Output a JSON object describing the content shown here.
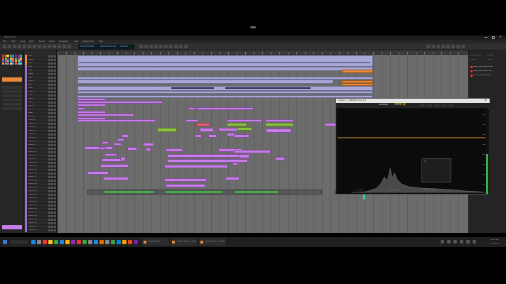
{
  "app": {
    "title": "Studio One"
  },
  "menus": [
    "File",
    "Edit",
    "Song",
    "Track",
    "Event",
    "Audio",
    "Transport",
    "View",
    "Studio One",
    "Help"
  ],
  "transport": {
    "time": "00:01:38.295",
    "bars": "0074.01.01.00",
    "tempo": "130.00",
    "signature": "4 / 4"
  },
  "tracks": [
    "Kick",
    "Snare",
    "Hat",
    "Perc",
    "Clap",
    "Bass",
    "Sub",
    "Chord",
    "Pad",
    "Lead",
    "Pluck",
    "Arp",
    "Keys",
    "Vox",
    "Vox 2",
    "FX",
    "Riser",
    "Impact",
    "Audio 1",
    "Audio 2",
    "Audio 3",
    "Audio 4",
    "Audio 5",
    "Audio 6",
    "Audio 7",
    "Audio 8",
    "Audio 9",
    "Audio 10",
    "Audio 11",
    "Audio 12",
    "Audio 13",
    "Audio 14",
    "Audio 15",
    "Audio 16",
    "Audio 17",
    "Audio 18",
    "Audio 19",
    "Audio 20",
    "Audio 21",
    "Audio 22",
    "Audio 23",
    "Audio 24",
    "Audio 25",
    "Audio 26",
    "Audio 27",
    "Audio 28",
    "Audio 29",
    "Audio 30",
    "Audio 31",
    "Audio 32"
  ],
  "plugin": {
    "window_title": "Insert 1 - FabFilter Pro-Q 3",
    "brand": "fabfilter",
    "product": "Pro-Q",
    "band_label": "1",
    "footer_left": "MIDI Learn",
    "footer_mid": "Zero Latency",
    "footer_right": "Oversampling"
  },
  "browser": {
    "tabs": [
      "Instruments",
      "Effects",
      "Loops",
      "Files"
    ],
    "items": [
      "New_Idea_Master.wav",
      "New_Idea_Stems.zip",
      "Vocals_Take_04.wav"
    ]
  },
  "taskbar": {
    "tabs": [
      "Mixing Guide",
      "Untitled Studio - Studio One",
      "Mixing Studio - master"
    ],
    "time": "12:45 PM",
    "date": "1/18/2024"
  },
  "colors": {
    "clip_purple": "#c77de8",
    "clip_lavender": "#a7a8d8",
    "clip_green": "#8cc23f",
    "clip_red": "#e4606d",
    "clip_orange": "#e8893a",
    "eq_line": "#d69b2c"
  }
}
